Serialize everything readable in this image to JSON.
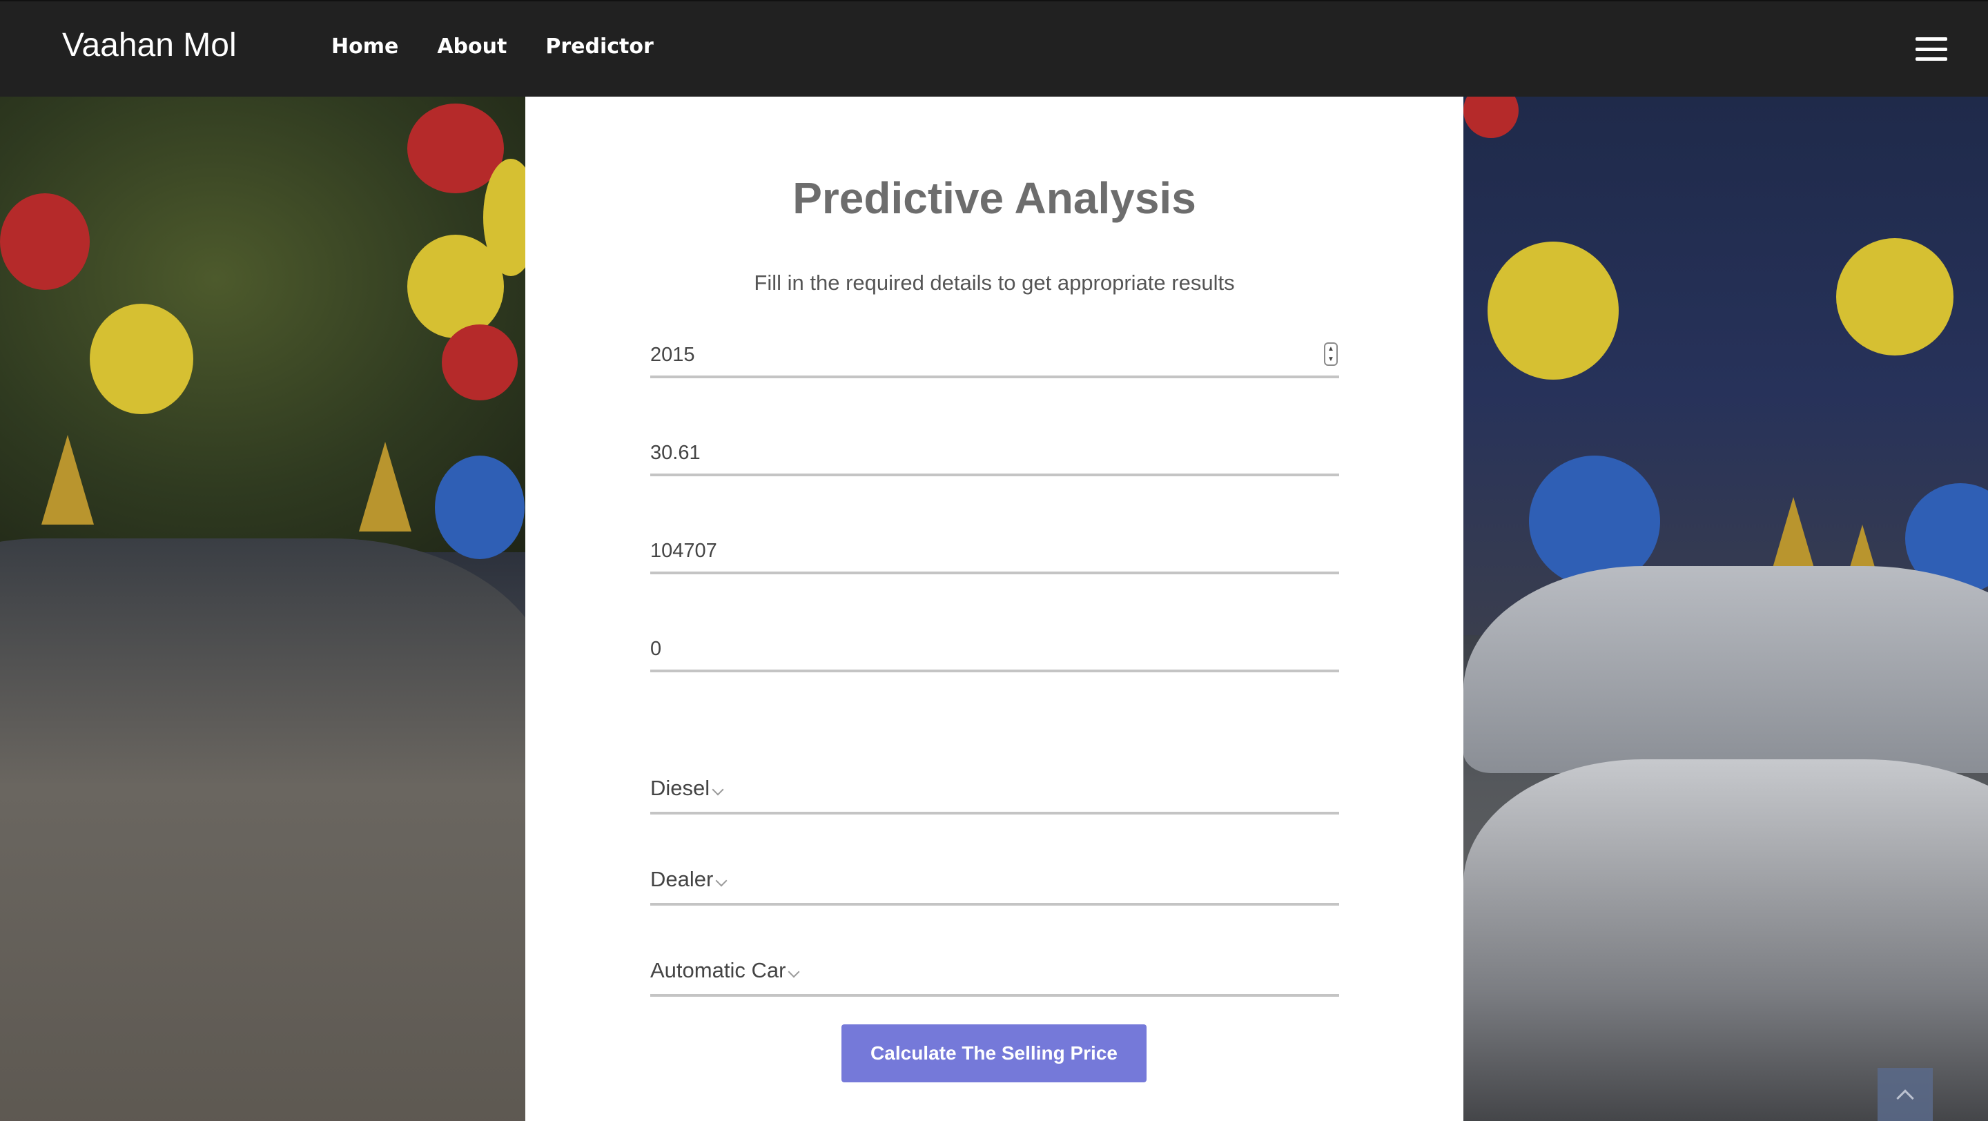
{
  "navbar": {
    "brand": "Vaahan Mol",
    "links": [
      "Home",
      "About",
      "Predictor"
    ]
  },
  "form": {
    "title": "Predictive Analysis",
    "subtitle": "Fill in the required details to get appropriate results",
    "year_value": "2015",
    "present_price_value": "30.61",
    "kms_driven_value": "104707",
    "owner_value": "0",
    "fuel_type_selected": "Diesel",
    "seller_type_selected": "Dealer",
    "transmission_selected": "Automatic Car",
    "submit_label": "Calculate The Selling Price"
  },
  "colors": {
    "navbar_bg": "#212121",
    "card_bg": "#ffffff",
    "button_bg": "#7579d9",
    "underline": "#c4c4c4"
  }
}
